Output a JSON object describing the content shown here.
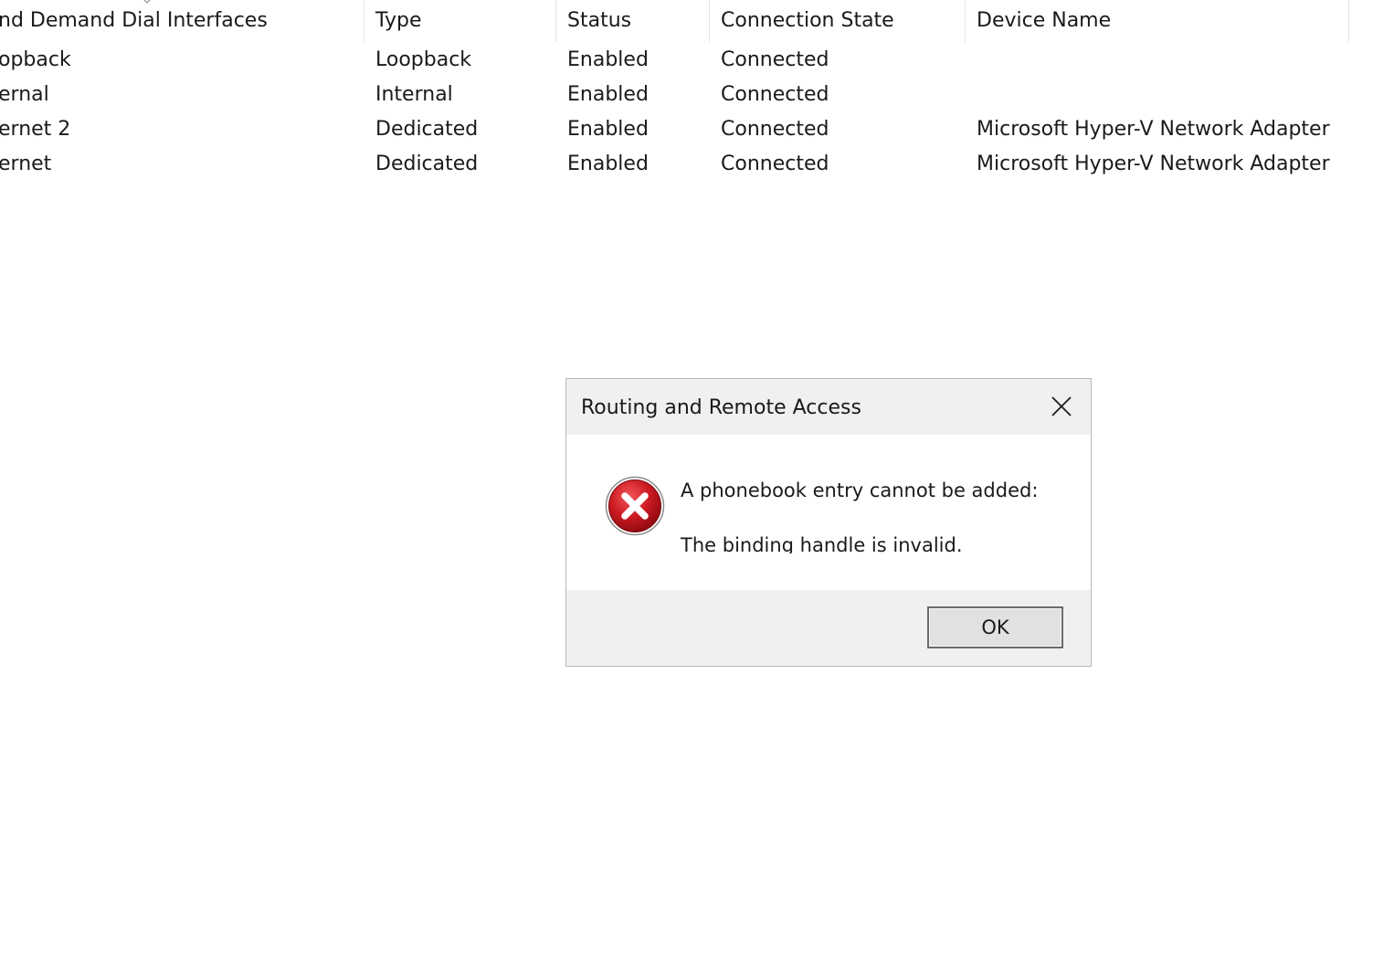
{
  "listview": {
    "columns": [
      "nd Demand Dial Interfaces",
      "Type",
      "Status",
      "Connection State",
      "Device Name"
    ],
    "rows": [
      {
        "name": "opback",
        "type": "Loopback",
        "status": "Enabled",
        "connection_state": "Connected",
        "device_name": ""
      },
      {
        "name": "ernal",
        "type": "Internal",
        "status": "Enabled",
        "connection_state": "Connected",
        "device_name": ""
      },
      {
        "name": "ernet 2",
        "type": "Dedicated",
        "status": "Enabled",
        "connection_state": "Connected",
        "device_name": "Microsoft Hyper-V Network Adapter"
      },
      {
        "name": "ernet",
        "type": "Dedicated",
        "status": "Enabled",
        "connection_state": "Connected",
        "device_name": "Microsoft Hyper-V Network Adapter"
      }
    ]
  },
  "dialog": {
    "title": "Routing and Remote Access",
    "icon": "error-icon",
    "message_line1": "A phonebook entry cannot be added:",
    "message_line2": "The binding handle is invalid.",
    "ok_label": "OK",
    "close_icon": "close-icon"
  },
  "colors": {
    "dialog_chrome": "#f0f0f0",
    "dialog_body": "#ffffff",
    "error_red": "#c8161d",
    "button_border": "#6b6b6b"
  }
}
